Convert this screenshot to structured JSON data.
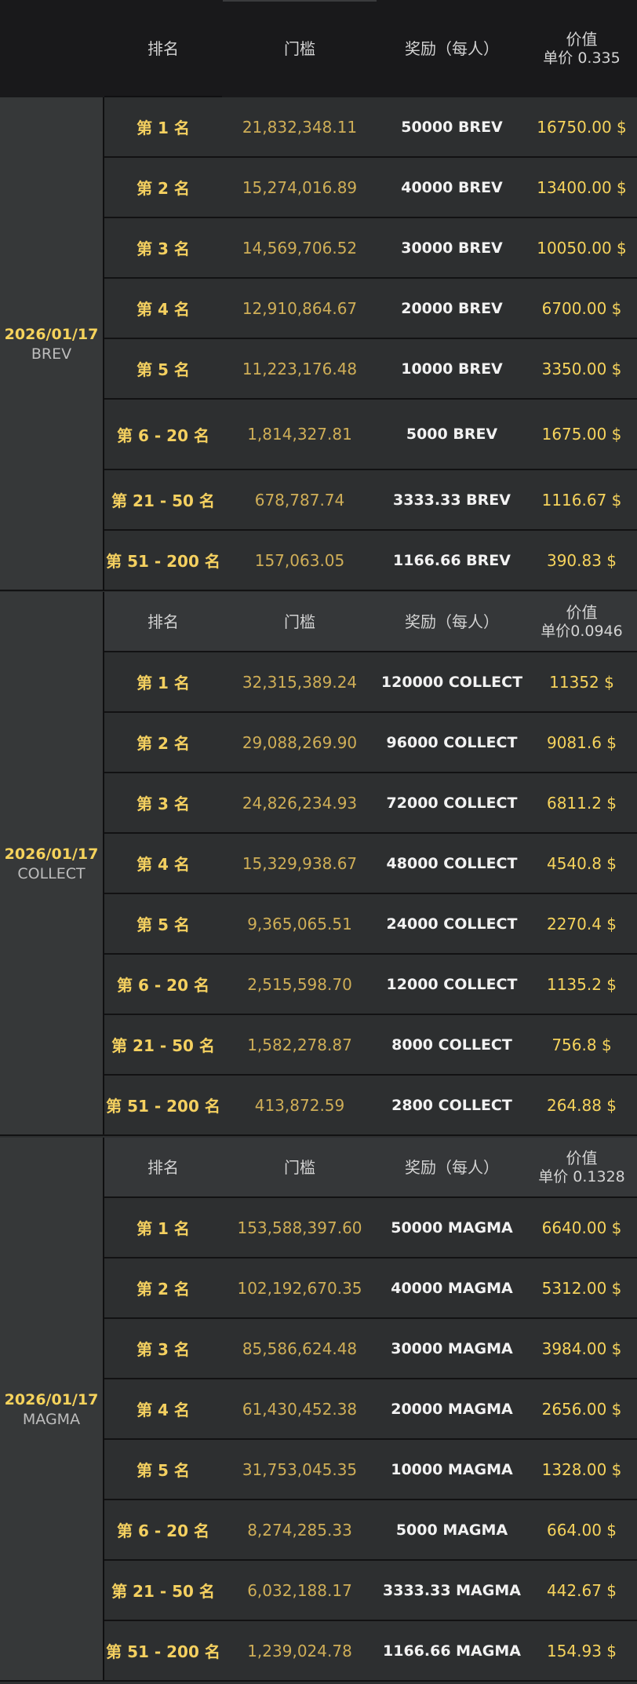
{
  "header": {
    "rank": "排名",
    "threshold": "门槛",
    "reward": "奖励（每人）",
    "value": "价值",
    "unit_price": "单价 0.335"
  },
  "groups": [
    {
      "date": "2026/01/17",
      "token": "BREV",
      "rows": [
        {
          "rank": "第 1 名",
          "threshold": "21,832,348.11",
          "reward": "50000 BREV",
          "value": "16750.00  $"
        },
        {
          "rank": "第 2 名",
          "threshold": "15,274,016.89",
          "reward": "40000 BREV",
          "value": "13400.00  $"
        },
        {
          "rank": "第 3 名",
          "threshold": "14,569,706.52",
          "reward": "30000 BREV",
          "value": "10050.00  $"
        },
        {
          "rank": "第 4 名",
          "threshold": "12,910,864.67",
          "reward": "20000 BREV",
          "value": "6700.00  $"
        },
        {
          "rank": "第 5 名",
          "threshold": "11,223,176.48",
          "reward": "10000 BREV",
          "value": "3350.00  $"
        },
        {
          "rank": "第 6 - 20 名",
          "threshold": "1,814,327.81",
          "reward": "5000 BREV",
          "value": "1675.00  $"
        },
        {
          "rank": "第 21 - 50 名",
          "threshold": "678,787.74",
          "reward": "3333.33 BREV",
          "value": "1116.67  $"
        },
        {
          "rank": "第 51 - 200 名",
          "threshold": "157,063.05",
          "reward": "1166.66 BREV",
          "value": "390.83  $"
        }
      ]
    },
    {
      "date": "2026/01/17",
      "token": "COLLECT",
      "subheader": {
        "rank": "排名",
        "threshold": "门槛",
        "reward": "奖励（每人）",
        "value": "价值",
        "unit_price": "单价0.0946"
      },
      "rows": [
        {
          "rank": "第 1 名",
          "threshold": "32,315,389.24",
          "reward": "120000 COLLECT",
          "value": "11352  $"
        },
        {
          "rank": "第 2 名",
          "threshold": "29,088,269.90",
          "reward": "96000 COLLECT",
          "value": "9081.6  $"
        },
        {
          "rank": "第 3 名",
          "threshold": "24,826,234.93",
          "reward": "72000 COLLECT",
          "value": "6811.2  $"
        },
        {
          "rank": "第 4 名",
          "threshold": "15,329,938.67",
          "reward": "48000 COLLECT",
          "value": "4540.8  $"
        },
        {
          "rank": "第 5 名",
          "threshold": "9,365,065.51",
          "reward": "24000 COLLECT",
          "value": "2270.4  $"
        },
        {
          "rank": "第 6 - 20 名",
          "threshold": "2,515,598.70",
          "reward": "12000 COLLECT",
          "value": "1135.2  $"
        },
        {
          "rank": "第 21 - 50 名",
          "threshold": "1,582,278.87",
          "reward": "8000 COLLECT",
          "value": "756.8  $"
        },
        {
          "rank": "第 51 - 200 名",
          "threshold": "413,872.59",
          "reward": "2800 COLLECT",
          "value": "264.88  $"
        }
      ]
    },
    {
      "date": "2026/01/17",
      "token": "MAGMA",
      "subheader": {
        "rank": "排名",
        "threshold": "门槛",
        "reward": "奖励（每人）",
        "value": "价值",
        "unit_price": "单价 0.1328"
      },
      "rows": [
        {
          "rank": "第 1 名",
          "threshold": "153,588,397.60",
          "reward": "50000 MAGMA",
          "value": "6640.00  $"
        },
        {
          "rank": "第 2 名",
          "threshold": "102,192,670.35",
          "reward": "40000 MAGMA",
          "value": "5312.00  $"
        },
        {
          "rank": "第 3 名",
          "threshold": "85,586,624.48",
          "reward": "30000 MAGMA",
          "value": "3984.00  $"
        },
        {
          "rank": "第 4 名",
          "threshold": "61,430,452.38",
          "reward": "20000 MAGMA",
          "value": "2656.00  $"
        },
        {
          "rank": "第 5 名",
          "threshold": "31,753,045.35",
          "reward": "10000 MAGMA",
          "value": "1328.00  $"
        },
        {
          "rank": "第 6 - 20 名",
          "threshold": "8,274,285.33",
          "reward": "5000 MAGMA",
          "value": "664.00  $"
        },
        {
          "rank": "第 21 - 50 名",
          "threshold": "6,032,188.17",
          "reward": "3333.33 MAGMA",
          "value": "442.67  $"
        },
        {
          "rank": "第 51 - 200 名",
          "threshold": "1,239,024.78",
          "reward": "1166.66 MAGMA",
          "value": "154.93  $"
        }
      ]
    }
  ]
}
